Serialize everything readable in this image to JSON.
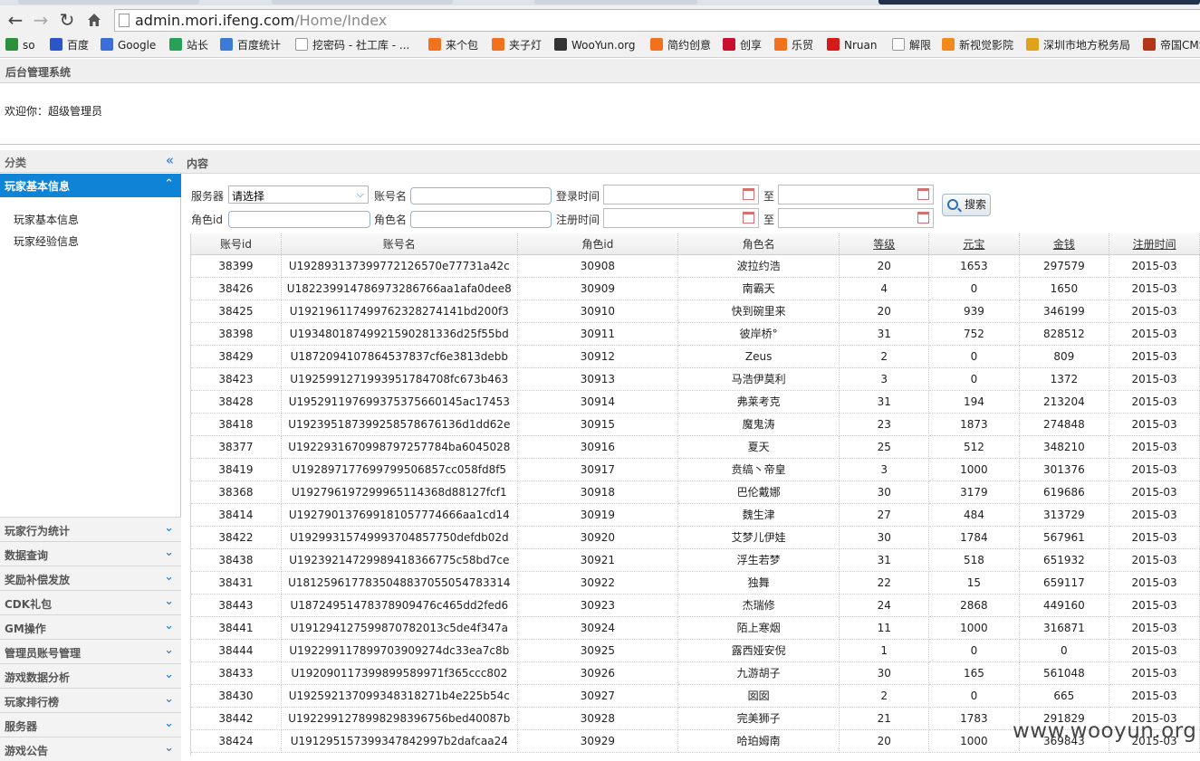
{
  "browser": {
    "url_host": "admin.mori.ifeng.com",
    "url_path": "/Home/Index",
    "bookmarks": [
      {
        "label": "so",
        "icon": "360-search-icon",
        "color": "#2c8f3c"
      },
      {
        "label": "百度",
        "icon": "baidu-paw-icon",
        "color": "#2b56c9"
      },
      {
        "label": "Google",
        "icon": "google-icon",
        "color": "#3b6fd6"
      },
      {
        "label": "站长",
        "icon": "cnzz-icon",
        "color": "#27a05a"
      },
      {
        "label": "百度统计",
        "icon": "chart-icon",
        "color": "#3b7ad6"
      },
      {
        "label": "挖密码 - 社工库 - ...",
        "icon": "page-icon",
        "color": "#ffffff"
      },
      {
        "label": "来个包",
        "icon": "taobao-icon",
        "color": "#f2711c"
      },
      {
        "label": "夹子灯",
        "icon": "taobao-icon",
        "color": "#f2711c"
      },
      {
        "label": "WooYun.org",
        "icon": "wooyun-icon",
        "color": "#333333"
      },
      {
        "label": "简约创意",
        "icon": "taobao-icon",
        "color": "#f2711c"
      },
      {
        "label": "创享",
        "icon": "t-icon",
        "color": "#c8102e"
      },
      {
        "label": "乐贸",
        "icon": "taobao-icon",
        "color": "#f2711c"
      },
      {
        "label": "Nruan",
        "icon": "n-icon",
        "color": "#d61a1a"
      },
      {
        "label": "解限",
        "icon": "page-icon",
        "color": "#ffffff"
      },
      {
        "label": "新视觉影院",
        "icon": "film-icon",
        "color": "#f08a1c"
      },
      {
        "label": "深圳市地方税务局",
        "icon": "tax-icon",
        "color": "#e0a21b"
      },
      {
        "label": "帝国CMS",
        "icon": "cms-icon",
        "color": "#b3361a"
      }
    ]
  },
  "site": {
    "title": "后台管理系统",
    "welcome": "欢迎你：超级管理员"
  },
  "sidebar": {
    "header": "分类",
    "active_group": "玩家基本信息",
    "sub_items": [
      "玩家基本信息",
      "玩家经验信息"
    ],
    "groups": [
      "玩家行为统计",
      "数据查询",
      "奖励补偿发放",
      "CDK礼包",
      "GM操作",
      "管理员账号管理",
      "游戏数据分析",
      "玩家排行榜",
      "服务器",
      "游戏公告"
    ]
  },
  "content": {
    "header": "内容",
    "form": {
      "server_label": "服务器",
      "server_value": "请选择",
      "account_name_label": "账号名",
      "login_time_label": "登录时间",
      "to_label_1": "至",
      "role_id_label": "角色id",
      "role_name_label": "角色名",
      "register_time_label": "注册时间",
      "to_label_2": "至",
      "search_button": "搜索"
    },
    "table": {
      "columns": [
        "账号id",
        "账号名",
        "角色id",
        "角色名",
        "等级",
        "元宝",
        "金钱",
        "注册时间"
      ],
      "rows": [
        [
          "38399",
          "U192893137399772126570e77731a42c",
          "30908",
          "波拉约浩",
          "20",
          "1653",
          "297579",
          "2015-03"
        ],
        [
          "38426",
          "U182239914786973286766aa1afa0dee8",
          "30909",
          "南霸天",
          "4",
          "0",
          "1650",
          "2015-03"
        ],
        [
          "38425",
          "U192196117499762328274141bd200f3",
          "30910",
          "快到碗里来",
          "20",
          "939",
          "346199",
          "2015-03"
        ],
        [
          "38398",
          "U193480187499215902813 36d25f55bd",
          "30911",
          "彼岸桥°",
          "31",
          "752",
          "828512",
          "2015-03"
        ],
        [
          "38429",
          "U187209410786453783 7cf6e3813debb",
          "30912",
          "Zeus",
          "2",
          "0",
          "809",
          "2015-03"
        ],
        [
          "38423",
          "U192599127199395178 4708fc673b463",
          "30913",
          "马浩伊莫利",
          "3",
          "0",
          "1372",
          "2015-03"
        ],
        [
          "38428",
          "U195291197699375375660145ac17453",
          "30914",
          "弗莱考克",
          "31",
          "194",
          "213204",
          "2015-03"
        ],
        [
          "38418",
          "U192395187399258578676136d1dd62e",
          "30915",
          "魔鬼涛",
          "23",
          "1873",
          "274848",
          "2015-03"
        ],
        [
          "38377",
          "U192293167099879725 7784ba6045028",
          "30916",
          "夏天",
          "25",
          "512",
          "348210",
          "2015-03"
        ],
        [
          "38419",
          "U192897177699799506857cc058fd8f5",
          "30917",
          "贲缟丶帝皇",
          "3",
          "1000",
          "301376",
          "2015-03"
        ],
        [
          "38368",
          "U192796197299965114368d88127fcf1",
          "30918",
          "巴伦戴娜",
          "30",
          "3179",
          "619686",
          "2015-03"
        ],
        [
          "38414",
          "U192790137699181057774666aa1cd14",
          "30919",
          "魏生津",
          "27",
          "484",
          "313729",
          "2015-03"
        ],
        [
          "38422",
          "U192993157499937048577 50defdb02d",
          "30920",
          "艾梦儿伊娃",
          "30",
          "1784",
          "567961",
          "2015-03"
        ],
        [
          "38438",
          "U192392147299894183667 75c58bd7ce",
          "30921",
          "浮生若梦",
          "31",
          "518",
          "651932",
          "2015-03"
        ],
        [
          "38431",
          "U181259617783504883705 5054783314",
          "30922",
          "独舞",
          "22",
          "15",
          "659117",
          "2015-03"
        ],
        [
          "38443",
          "U187249514783789094 76c465dd2fed6",
          "30923",
          "杰瑞修",
          "24",
          "2868",
          "449160",
          "2015-03"
        ],
        [
          "38441",
          "U191294127599870782013c5de4f347a",
          "30924",
          "陌上寒烟",
          "11",
          "1000",
          "316871",
          "2015-03"
        ],
        [
          "38444",
          "U192299117899703909274dc33ea7c8b",
          "30925",
          "露西娅安倪",
          "1",
          "0",
          "0",
          "2015-03"
        ],
        [
          "38433",
          "U192090117399899589971f365ccc802",
          "30926",
          "九游胡子",
          "30",
          "165",
          "561048",
          "2015-03"
        ],
        [
          "38430",
          "U192592137099348318271b4e225b54c",
          "30927",
          "囡囡",
          "2",
          "0",
          "665",
          "2015-03"
        ],
        [
          "38442",
          "U192299127899829839 6756bed40087b",
          "30928",
          "完美狮子",
          "21",
          "1783",
          "291829",
          "2015-03"
        ],
        [
          "38424",
          "U191295157399347842997b2dafcaa24",
          "30929",
          "哈珀姆南",
          "20",
          "1000",
          "369843",
          "2015-03"
        ]
      ]
    }
  },
  "watermark": "www.wooyun.org"
}
